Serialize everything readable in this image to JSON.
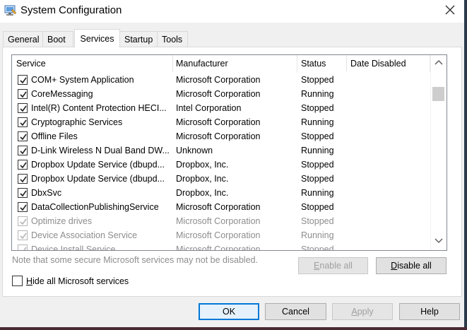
{
  "window": {
    "title": "System Configuration",
    "icon": "system-config-icon",
    "close_icon": "close-icon"
  },
  "tabs": [
    {
      "label": "General",
      "active": false
    },
    {
      "label": "Boot",
      "active": false
    },
    {
      "label": "Services",
      "active": true
    },
    {
      "label": "Startup",
      "active": false
    },
    {
      "label": "Tools",
      "active": false
    }
  ],
  "services": {
    "columns": {
      "service": "Service",
      "manufacturer": "Manufacturer",
      "status": "Status",
      "date_disabled": "Date Disabled"
    },
    "rows": [
      {
        "name": "COM+ System Application",
        "manufacturer": "Microsoft Corporation",
        "status": "Stopped",
        "date_disabled": "",
        "checked": true,
        "enabled": true
      },
      {
        "name": "CoreMessaging",
        "manufacturer": "Microsoft Corporation",
        "status": "Running",
        "date_disabled": "",
        "checked": true,
        "enabled": true
      },
      {
        "name": "Intel(R) Content Protection HECI...",
        "manufacturer": "Intel Corporation",
        "status": "Stopped",
        "date_disabled": "",
        "checked": true,
        "enabled": true
      },
      {
        "name": "Cryptographic Services",
        "manufacturer": "Microsoft Corporation",
        "status": "Running",
        "date_disabled": "",
        "checked": true,
        "enabled": true
      },
      {
        "name": "Offline Files",
        "manufacturer": "Microsoft Corporation",
        "status": "Stopped",
        "date_disabled": "",
        "checked": true,
        "enabled": true
      },
      {
        "name": "D-Link Wireless N Dual Band DW...",
        "manufacturer": "Unknown",
        "status": "Running",
        "date_disabled": "",
        "checked": true,
        "enabled": true
      },
      {
        "name": "Dropbox Update Service (dbupd...",
        "manufacturer": "Dropbox, Inc.",
        "status": "Stopped",
        "date_disabled": "",
        "checked": true,
        "enabled": true
      },
      {
        "name": "Dropbox Update Service (dbupd...",
        "manufacturer": "Dropbox, Inc.",
        "status": "Stopped",
        "date_disabled": "",
        "checked": true,
        "enabled": true
      },
      {
        "name": "DbxSvc",
        "manufacturer": "Dropbox, Inc.",
        "status": "Running",
        "date_disabled": "",
        "checked": true,
        "enabled": true
      },
      {
        "name": "DataCollectionPublishingService",
        "manufacturer": "Microsoft Corporation",
        "status": "Stopped",
        "date_disabled": "",
        "checked": true,
        "enabled": true
      },
      {
        "name": "Optimize drives",
        "manufacturer": "Microsoft Corporation",
        "status": "Stopped",
        "date_disabled": "",
        "checked": true,
        "enabled": false
      },
      {
        "name": "Device Association Service",
        "manufacturer": "Microsoft Corporation",
        "status": "Running",
        "date_disabled": "",
        "checked": true,
        "enabled": false
      },
      {
        "name": "Device Install Service",
        "manufacturer": "Microsoft Corporation",
        "status": "Stopped",
        "date_disabled": "",
        "checked": true,
        "enabled": false
      }
    ]
  },
  "note": "Note that some secure Microsoft services may not be disabled.",
  "buttons": {
    "enable_all": "Enable all",
    "disable_all": "Disable all",
    "ok": "OK",
    "cancel": "Cancel",
    "apply": "Apply",
    "help": "Help"
  },
  "hide_ms": {
    "label": "Hide all Microsoft services",
    "checked": false
  },
  "colors": {
    "accent": "#0078d7",
    "disabled_text": "#8d8d8d"
  }
}
